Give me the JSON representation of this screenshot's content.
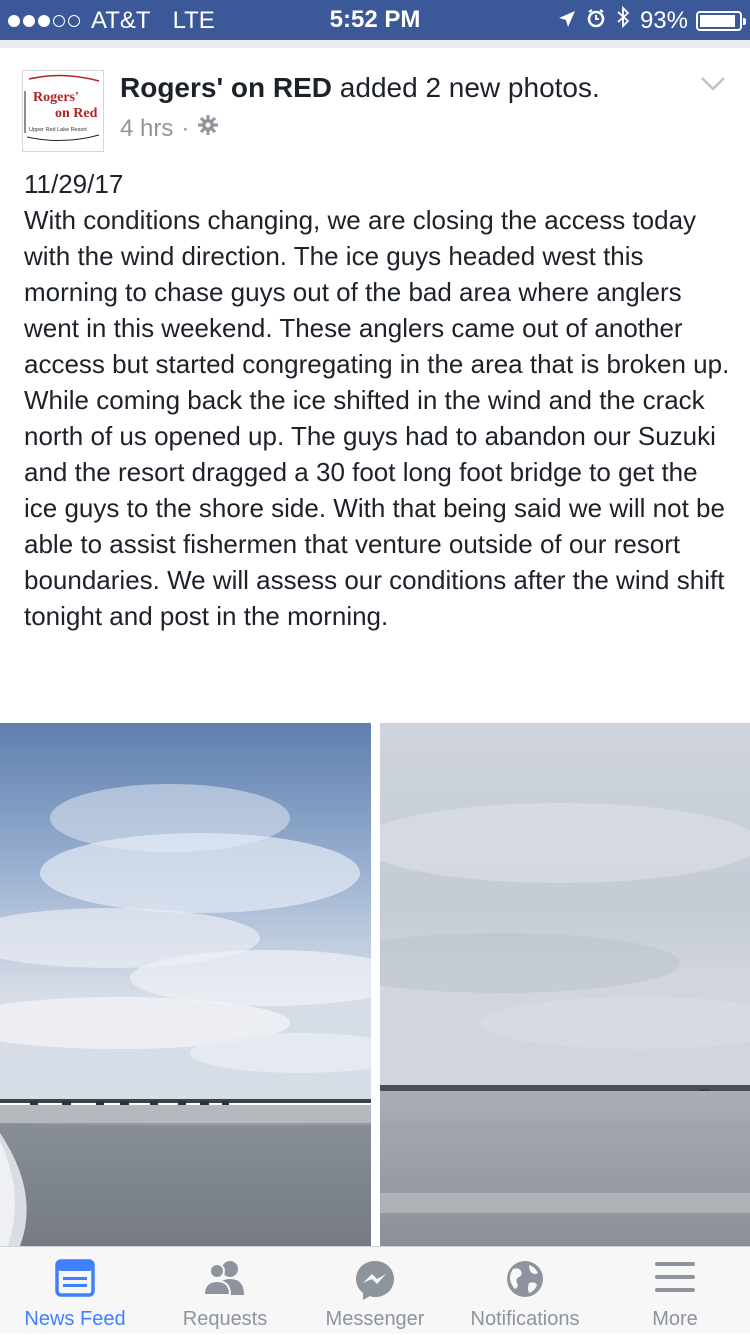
{
  "status_bar": {
    "carrier": "AT&T",
    "network": "LTE",
    "time": "5:52 PM",
    "battery": "93%",
    "battery_level": 0.93,
    "signal_bars": 3
  },
  "post": {
    "author": "Rogers' on RED",
    "action": "added 2 new photos.",
    "time_ago": "4 hrs",
    "separator": "·",
    "avatar_logo": {
      "line1": "Rogers'",
      "line2": "on Red",
      "line3": "Upper Red Lake Resort"
    },
    "date": "11/29/17",
    "text": "With conditions changing, we are closing the access today with the wind direction. The ice guys headed west this morning to chase guys out of the bad area where anglers went in this weekend. These anglers came out of another access but started congregating in the area that is broken up. While coming back the ice shifted in the wind and the crack north of us opened up. The guys had to abandon our Suzuki and the resort dragged a 30 foot long foot bridge to get the ice guys to the shore side. With that being said we will not be able to assist fishermen that venture outside of our resort boundaries. We will assess our conditions after the wind shift tonight and post in the morning."
  },
  "tabs": [
    {
      "label": "News Feed",
      "icon": "news-feed-icon",
      "active": true
    },
    {
      "label": "Requests",
      "icon": "friends-icon",
      "active": false
    },
    {
      "label": "Messenger",
      "icon": "messenger-icon",
      "active": false
    },
    {
      "label": "Notifications",
      "icon": "globe-icon",
      "active": false
    },
    {
      "label": "More",
      "icon": "menu-icon",
      "active": false
    }
  ],
  "colors": {
    "status_bar_bg": "#3b5998",
    "active_tab": "#4080ff",
    "inactive_tab": "#8d949e",
    "meta_text": "#90949c"
  }
}
